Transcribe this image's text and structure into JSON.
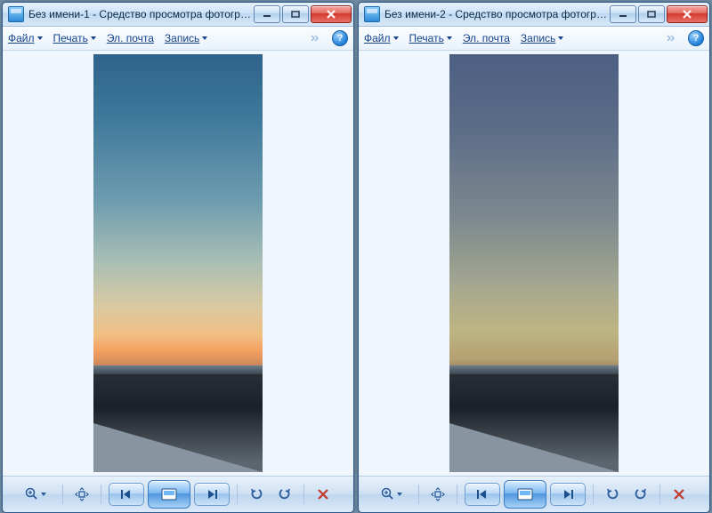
{
  "windows": [
    {
      "title": "Без имени-1 - Средство просмотра фотографий ...",
      "menu": {
        "file": "Файл",
        "print": "Печать",
        "email": "Эл. почта",
        "record": "Запись",
        "help": "?"
      },
      "photo_variant": "a"
    },
    {
      "title": "Без имени-2 - Средство просмотра фотографий ...",
      "menu": {
        "file": "Файл",
        "print": "Печать",
        "email": "Эл. почта",
        "record": "Запись",
        "help": "?"
      },
      "photo_variant": "b"
    }
  ]
}
